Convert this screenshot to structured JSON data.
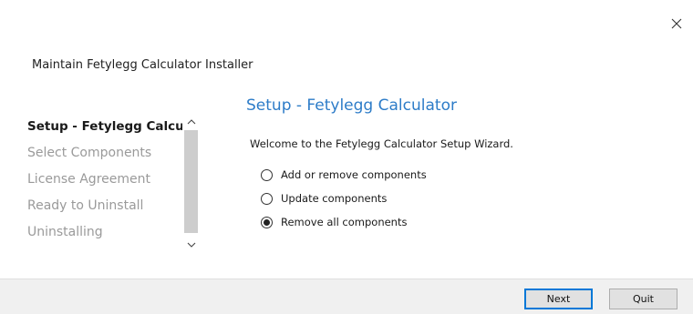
{
  "window": {
    "title": "Maintain Fetylegg Calculator Installer",
    "close_icon": "close-icon"
  },
  "sidebar": {
    "steps": [
      {
        "label": "Setup - Fetylegg Calcu...",
        "active": true
      },
      {
        "label": "Select Components",
        "active": false
      },
      {
        "label": "License Agreement",
        "active": false
      },
      {
        "label": "Ready to Uninstall",
        "active": false
      },
      {
        "label": "Uninstalling",
        "active": false
      }
    ],
    "scrollbar": {
      "up_icon": "chevron-up-icon",
      "down_icon": "chevron-down-icon"
    }
  },
  "main": {
    "title": "Setup - Fetylegg Calculator",
    "welcome": "Welcome to the Fetylegg Calculator Setup Wizard.",
    "options": [
      {
        "label": "Add or remove components",
        "checked": false
      },
      {
        "label": "Update components",
        "checked": false
      },
      {
        "label": "Remove all components",
        "checked": true
      }
    ]
  },
  "footer": {
    "next_label": "Next",
    "quit_label": "Quit"
  },
  "colors": {
    "accent": "#2d7cc8",
    "button_focus": "#0078d7",
    "footer_bg": "#f0f0f0"
  }
}
